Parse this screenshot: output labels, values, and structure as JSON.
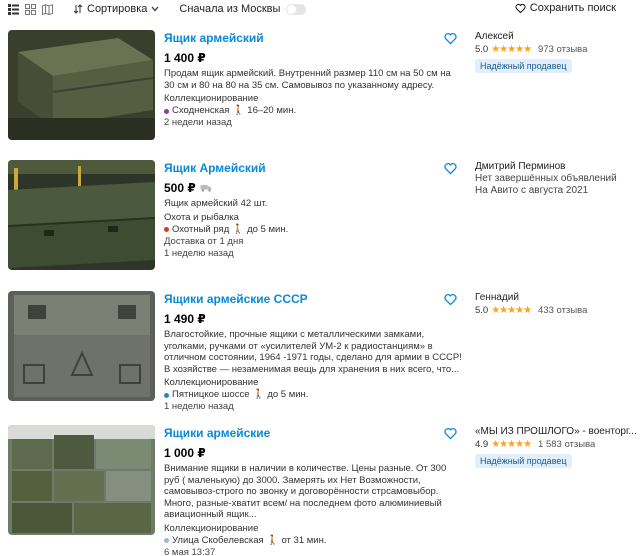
{
  "toolbar": {
    "sort_label": "Сортировка",
    "moscow_label": "Сначала из Москвы",
    "save_search_label": "Сохранить поиск"
  },
  "listings": [
    {
      "title": "Ящик армейский",
      "price": "1 400 ₽",
      "description": "Продам ящик армейский. Внутренний размер 110 см на 50 см на 30 см и 80 на 80 на 35 см. Самовывоз по указанному адресу.",
      "category": "Коллекционирование",
      "metro": "Сходненская",
      "metro_color": "#8e3d9e",
      "distance": "16–20 мин.",
      "extra": "",
      "posted": "2 недели назад",
      "seller": {
        "name": "Алексей",
        "rating": "5.0",
        "reviews": "973 отзыва",
        "badge": "Надёжный продавец",
        "line1": "",
        "line2": ""
      }
    },
    {
      "title": "Ящик Армейский",
      "price": "500 ₽",
      "description": "Ящик армейский 42 шт.",
      "category": "Охота и рыбалка",
      "metro": "Охотный ряд",
      "metro_color": "#d83a2c",
      "distance": "до 5 мин.",
      "extra": "Доставка от 1 дня",
      "posted": "1 неделю назад",
      "seller": {
        "name": "Дмитрий Перминов",
        "rating": "",
        "reviews": "",
        "badge": "",
        "line1": "Нет завершённых объявлений",
        "line2": "На Авито с августа 2021"
      }
    },
    {
      "title": "Ящики армейские СССР",
      "price": "1 490 ₽",
      "description": "Влагостойкие, прочные ящики с металлическими замками, уголками, ручками от «усилителей УМ-2 к радиостанциям» в отличном состоянии, 1964 -1971 годы, сделано для армии в СССР! В хозяйстве — незаменимая вещь для хранения в них всего, что...",
      "category": "Коллекционирование",
      "metro": "Пятницкое шоссе",
      "metro_color": "#2e86c1",
      "distance": "до 5 мин.",
      "extra": "",
      "posted": "1 неделю назад",
      "seller": {
        "name": "Геннадий",
        "rating": "5.0",
        "reviews": "433 отзыва",
        "badge": "",
        "line1": "",
        "line2": ""
      }
    },
    {
      "title": "Ящики армейские",
      "price": "1 000 ₽",
      "description": "Внимание ящики в наличии в количестве. Цены разные. От 300 руб ( маленькую) до 3000. Замерять их Нет Возможности, самовывоз-строго по звонку и договорённости стрсамовыбор. Много, разные-хватит всем/ на последнем фото алюминиевый авиационный ящик...",
      "category": "Коллекционирование",
      "metro": "Улица Скобелевская",
      "metro_color": "#a3b3d6",
      "distance": "от 31 мин.",
      "extra": "",
      "posted": "6 мая 13:37",
      "seller": {
        "name": "«МЫ ИЗ ПРОШЛОГО» - военторг...",
        "rating": "4.9",
        "reviews": "1 583 отзыва",
        "badge": "Надёжный продавец",
        "line1": "",
        "line2": ""
      }
    }
  ],
  "stars": "★★★★★",
  "colors": {
    "accent": "#0a8ad6",
    "star": "#ffa31a",
    "badge_bg": "#e0effb"
  }
}
